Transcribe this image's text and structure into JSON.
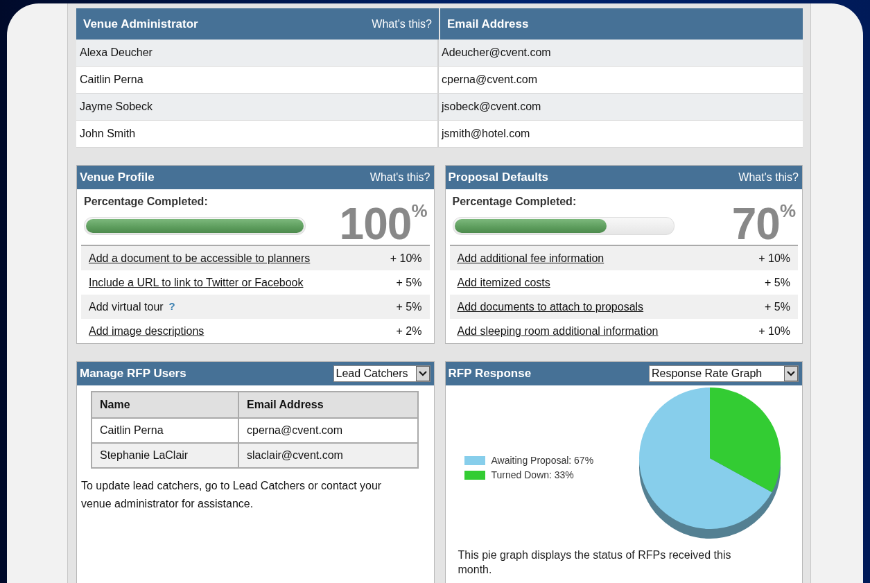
{
  "admin_table": {
    "title": "Venue Administrator",
    "help": "What's this?",
    "email_heading": "Email Address",
    "rows": [
      {
        "name": "Alexa Deucher",
        "email": "Adeucher@cvent.com"
      },
      {
        "name": "Caitlin Perna",
        "email": "cperna@cvent.com"
      },
      {
        "name": "Jayme Sobeck",
        "email": "jsobeck@cvent.com"
      },
      {
        "name": "John Smith",
        "email": "jsmith@hotel.com"
      }
    ]
  },
  "progress_panels": [
    {
      "title": "Venue Profile",
      "help": "What's this?",
      "label": "Percentage Completed:",
      "level": 1.0,
      "percent": "100$^{%}$",
      "tasks": [
        {
          "kind": "link",
          "label": "Add a document to be accessible to planners",
          "points": "+ 10%"
        },
        {
          "kind": "link",
          "label": "Include a URL to link to Twitter or Facebook",
          "points": "+ 5%"
        },
        {
          "kind": "help",
          "label": "Add virtual tour",
          "help_icon": "?",
          "points": "+ 5%"
        },
        {
          "kind": "link",
          "label": "Add image descriptions",
          "points": "+ 2%"
        }
      ]
    },
    {
      "title": "Proposal Defaults",
      "help": "What's this?",
      "label": "Percentage Completed:",
      "level": 0.7,
      "percent": "70$^{%}$",
      "tasks": [
        {
          "kind": "link",
          "label": "Add additional fee information",
          "points": "+ 10%"
        },
        {
          "kind": "link",
          "label": "Add itemized costs",
          "points": "+ 5%"
        },
        {
          "kind": "link",
          "label": "Add documents to attach to proposals",
          "points": "+ 5%"
        },
        {
          "kind": "link",
          "label": "Add sleeping room additional information",
          "points": "+ 10%"
        }
      ]
    }
  ],
  "rfp_users": {
    "title": "Manage RFP Users",
    "dropdown": "Lead Catchers",
    "columns": [
      "Name",
      "Email Address"
    ],
    "rows": [
      {
        "name": "Caitlin Perna",
        "email": "cperna@cvent.com"
      },
      {
        "name": "Stephanie LaClair",
        "email": "slaclair@cvent.com"
      }
    ],
    "note": {
      "before": "To update lead catchers, go to",
      "link": "Lead Catchers",
      "after": "or contact your venue administrator for assistance."
    }
  },
  "rfp_response": {
    "title": "RFP Response",
    "dropdown": "Response Rate Graph",
    "legend": [
      {
        "label": "Awaiting Proposal: 67%",
        "color": "#87ceeb"
      },
      {
        "label": "Turned Down: 33%",
        "color": "#33cc33"
      }
    ],
    "chart_data": {
      "type": "pie",
      "values": [
        67,
        33
      ]
    },
    "caption": "This pie graph displays the status of RFPs received this month."
  }
}
